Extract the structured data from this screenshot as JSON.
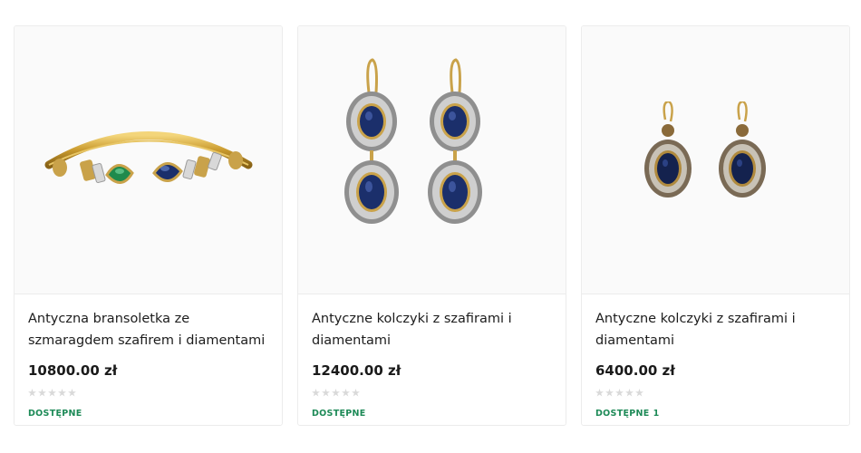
{
  "products": [
    {
      "title": "Antyczna bransoletka ze szmaragdem szafirem i diamentami",
      "price": "10800.00 zł",
      "rating": 0,
      "availability": "DOSTĘPNE",
      "count": "",
      "image_icon": "bracelet-image"
    },
    {
      "title": "Antyczne kolczyki z szafirami i diamentami",
      "price": "12400.00 zł",
      "rating": 0,
      "availability": "DOSTĘPNE",
      "count": "",
      "image_icon": "earrings-drop-image"
    },
    {
      "title": "Antyczne kolczyki z szafirami i diamentami",
      "price": "6400.00 zł",
      "rating": 0,
      "availability": "DOSTĘPNE",
      "count": "1",
      "image_icon": "earrings-stud-image"
    }
  ],
  "colors": {
    "availability": "#1d8a57",
    "star_empty": "#d9d9d9",
    "gold": "#c9a24a",
    "sapphire": "#1b2f6b",
    "emerald": "#1f8a4c"
  }
}
